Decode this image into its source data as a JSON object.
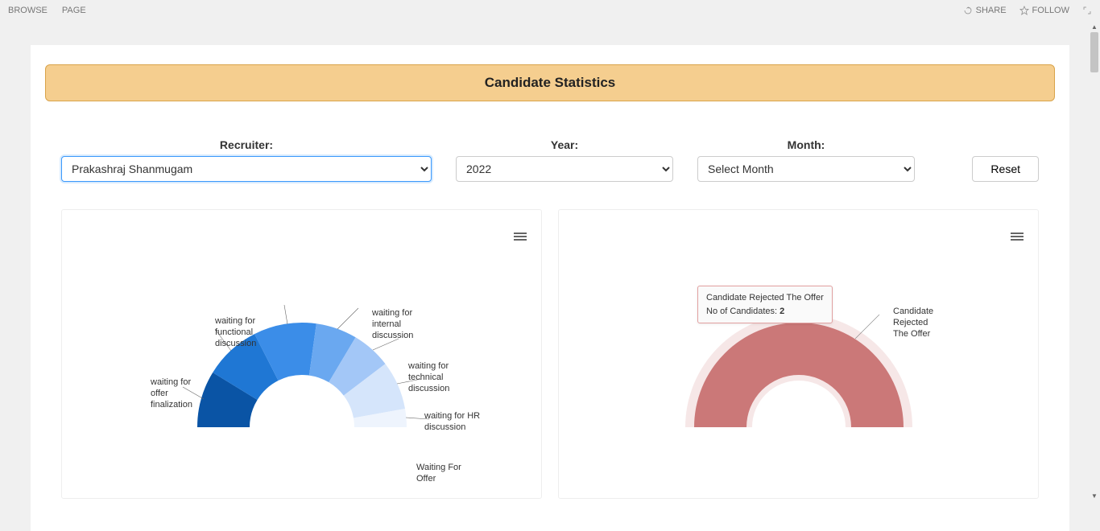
{
  "ribbon": {
    "browse": "BROWSE",
    "page": "PAGE",
    "share": "SHARE",
    "follow": "FOLLOW"
  },
  "title": "Candidate Statistics",
  "filters": {
    "recruiter_label": "Recruiter:",
    "recruiter_value": "Prakashraj Shanmugam",
    "year_label": "Year:",
    "year_value": "2022",
    "month_label": "Month:",
    "month_value": "Select Month",
    "reset": "Reset"
  },
  "chart_left": {
    "labels": {
      "offer_finalization": "waiting for offer finalization",
      "functional": "waiting for functional discussion",
      "internal": "waiting for internal discussion",
      "technical": "waiting for technical discussion",
      "hr": "waiting for HR discussion",
      "waiting_offer": "Waiting For Offer"
    }
  },
  "chart_right": {
    "label_rejected": "Candidate Rejected The Offer",
    "tooltip_title": "Candidate Rejected The Offer",
    "tooltip_subtitle_prefix": "No of Candidates: ",
    "tooltip_value": "2"
  },
  "chart_data": [
    {
      "type": "pie",
      "title": "Candidate Pipeline",
      "variant": "half-donut",
      "series": [
        {
          "name": "waiting for offer finalization",
          "value": 3,
          "color": "#0a54a5"
        },
        {
          "name": "waiting for functional discussion",
          "value": 3,
          "color": "#1f77d4"
        },
        {
          "name": "waiting for internal discussion",
          "value": 3,
          "color": "#3b8de8"
        },
        {
          "name": "waiting for technical discussion",
          "value": 2,
          "color": "#6aa8f0"
        },
        {
          "name": "waiting for HR discussion",
          "value": 1,
          "color": "#a3c7f7"
        },
        {
          "name": "Waiting For Offer",
          "value": 1,
          "color": "#d5e5fb"
        }
      ]
    },
    {
      "type": "pie",
      "title": "Candidate Rejections",
      "variant": "half-donut",
      "series": [
        {
          "name": "Candidate Rejected The Offer",
          "value": 2,
          "color": "#cb7878"
        }
      ]
    }
  ]
}
